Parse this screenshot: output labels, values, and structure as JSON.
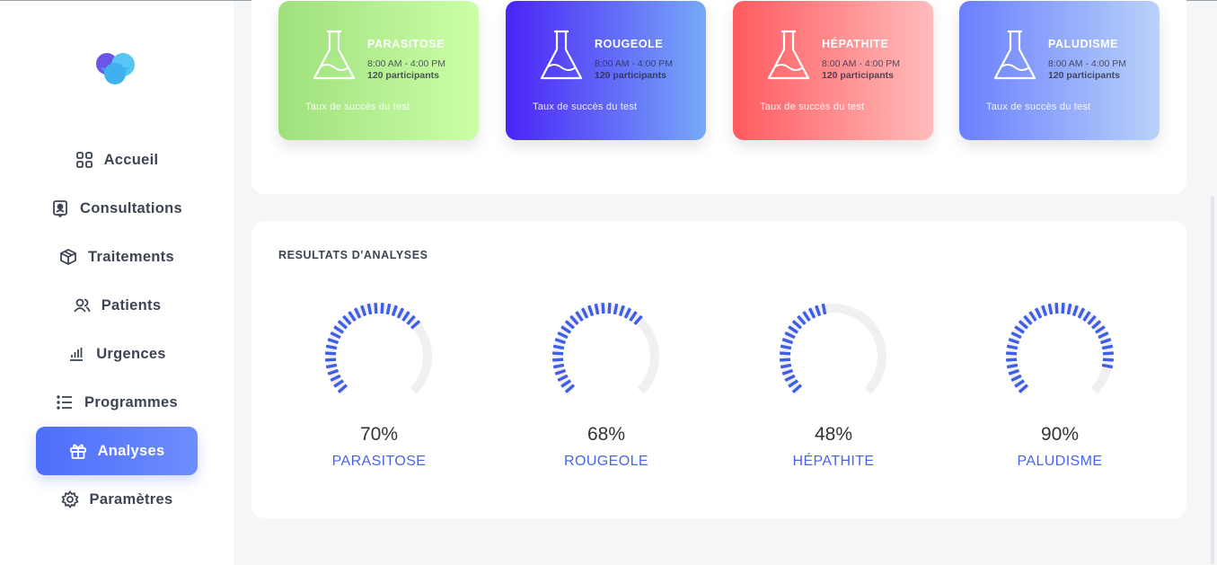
{
  "sidebar": {
    "logo": "heart-logo",
    "items": [
      {
        "label": "Accueil",
        "icon": "grid-icon"
      },
      {
        "label": "Consultations",
        "icon": "contact-icon"
      },
      {
        "label": "Traitements",
        "icon": "box-icon"
      },
      {
        "label": "Patients",
        "icon": "users-icon"
      },
      {
        "label": "Urgences",
        "icon": "bars-icon"
      },
      {
        "label": "Programmes",
        "icon": "list-icon"
      },
      {
        "label": "Analyses",
        "icon": "gift-icon",
        "active": true
      },
      {
        "label": "Paramètres",
        "icon": "gear-icon"
      }
    ]
  },
  "cards": [
    {
      "title": "PARASITOSE",
      "time": "8:00 AM - 4:00 PM",
      "participants": "120 participants",
      "subtitle": "Taux de succès du test",
      "gradient": [
        "#9fe07c",
        "#cbffa8"
      ]
    },
    {
      "title": "ROUGEOLE",
      "time": "8:00 AM - 4:00 PM",
      "participants": "120 participants",
      "subtitle": "Taux de succès du test",
      "gradient": [
        "#4b24f7",
        "#76a9f7"
      ]
    },
    {
      "title": "HÉPATHITE",
      "time": "8:00 AM - 4:00 PM",
      "participants": "120 participants",
      "subtitle": "Taux de succès du test",
      "gradient": [
        "#ff5a5f",
        "#ffbcbc"
      ]
    },
    {
      "title": "PALUDISME",
      "time": "8:00 AM - 4:00 PM",
      "participants": "120 participants",
      "subtitle": "Taux de succès du test",
      "gradient": [
        "#6a7ffc",
        "#b9d2fa"
      ]
    }
  ],
  "results": {
    "title": "RESULTATS D'ANALYSES",
    "accent": "#3e5de8",
    "track": "#f0f0f0",
    "gauges": [
      {
        "percent_text": "70%",
        "value": 0.7,
        "label": "PARASITOSE"
      },
      {
        "percent_text": "68%",
        "value": 0.68,
        "label": "ROUGEOLE"
      },
      {
        "percent_text": "48%",
        "value": 0.48,
        "label": "HÉPATHITE"
      },
      {
        "percent_text": "90%",
        "value": 0.9,
        "label": "PALUDISME"
      }
    ]
  }
}
